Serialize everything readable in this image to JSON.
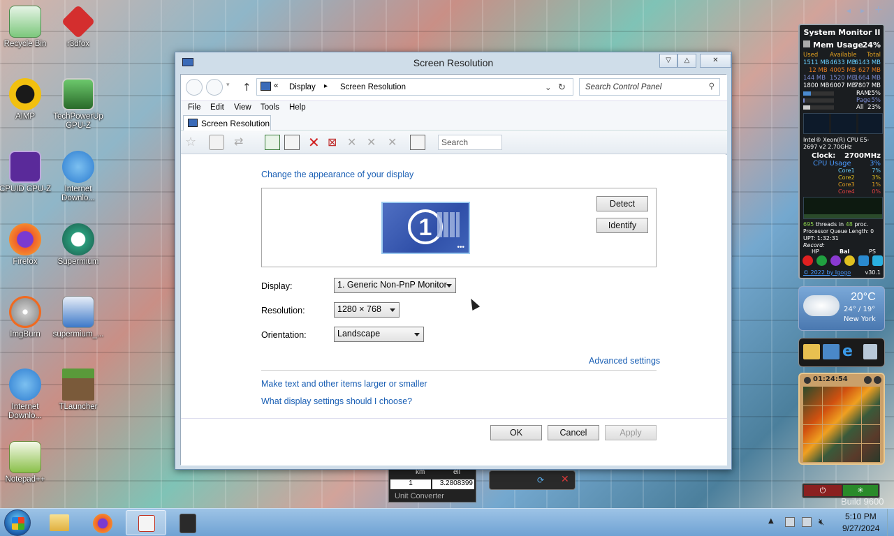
{
  "desktop": {
    "icons": [
      {
        "label": "Recycle Bin",
        "icon": "recycle-bin-icon",
        "color": "#3da63d"
      },
      {
        "label": "r3dfox",
        "icon": "r3dfox-icon",
        "color": "#d42e2e"
      },
      {
        "label": "AIMP",
        "icon": "aimp-icon",
        "color": "#f2c00f"
      },
      {
        "label": "TechPowerUp GPU-Z",
        "icon": "gpuz-icon",
        "color": "#4ca84c"
      },
      {
        "label": "CPUID CPU-Z",
        "icon": "cpuz-icon",
        "color": "#5a2a9a"
      },
      {
        "label": "Internet Downlo...",
        "icon": "idm-icon",
        "color": "#2b7bd0"
      },
      {
        "label": "Firefox",
        "icon": "firefox-icon",
        "color": "#f0602a"
      },
      {
        "label": "Supermium",
        "icon": "supermium-icon",
        "color": "#2a9a7a"
      },
      {
        "label": "ImgBurn",
        "icon": "imgburn-icon",
        "color": "#c8c8c8"
      },
      {
        "label": "supermium_...",
        "icon": "installer-icon",
        "color": "#3c78c8"
      },
      {
        "label": "Internet Downlo...",
        "icon": "idm-icon",
        "color": "#2b7bd0"
      },
      {
        "label": "TLauncher",
        "icon": "minecraft-icon",
        "color": "#5a8a3a"
      },
      {
        "label": "Notepad++",
        "icon": "notepadpp-icon",
        "color": "#8ac04a"
      }
    ]
  },
  "window": {
    "title": "Screen Resolution",
    "breadcrumb": {
      "chev": "«",
      "part1": "Display",
      "sep": "▸",
      "part2": "Screen Resolution"
    },
    "search_placeholder": "Search Control Panel",
    "menu": [
      "File",
      "Edit",
      "View",
      "Tools",
      "Help"
    ],
    "tab": "Screen Resolution",
    "toolbar_search": "Search",
    "content": {
      "heading": "Change the appearance of your display",
      "monitor_number": "1",
      "detect": "Detect",
      "identify": "Identify",
      "display_label": "Display:",
      "display_value": "1. Generic Non-PnP Monitor",
      "resolution_label": "Resolution:",
      "resolution_value": "1280 × 768",
      "orientation_label": "Orientation:",
      "orientation_value": "Landscape",
      "advanced": "Advanced settings",
      "link1": "Make text and other items larger or smaller",
      "link2": "What display settings should I choose?",
      "ok": "OK",
      "cancel": "Cancel",
      "apply": "Apply"
    }
  },
  "unit_converter": {
    "col1": "km",
    "col2": "ell",
    "val1": "1",
    "val2": "3.2808399",
    "label": "Unit Converter"
  },
  "sysmon": {
    "title": "System Monitor II",
    "mem_label": "Mem Usage",
    "mem_pct": "24%",
    "hdr": [
      "Used",
      "Available",
      "Total"
    ],
    "rows": [
      [
        "1511 MB",
        "4633 MB",
        "6143 MB"
      ],
      [
        "12 MB",
        "4005 MB",
        "627 MB"
      ],
      [
        "144 MB",
        "1520 MB",
        "1664 MB"
      ],
      [
        "1800 MB",
        "6007 MB",
        "7807 MB"
      ]
    ],
    "ram_label": "RAM",
    "ram_pct": "25%",
    "page_label": "Page",
    "page_pct": "5%",
    "all_label": "All",
    "all_pct": "23%",
    "cpu_name": "Intel® Xeon(R) CPU E5-2697 v2 2.70GHz",
    "clock_label": "Clock:",
    "clock_value": "2700MHz",
    "cpu_usage_label": "CPU Usage",
    "cpu_usage": "3%",
    "cores": [
      [
        "Core1",
        "7%"
      ],
      [
        "Core2",
        "3%"
      ],
      [
        "Core3",
        "1%"
      ],
      [
        "Core4",
        "0%"
      ]
    ],
    "threads": "695",
    "threads_text": "threads in",
    "procs": "48",
    "procs_text": "proc.",
    "queue": "Processor Queue Length: 0",
    "upt": "UPT: 1:32:31",
    "record": "Record:",
    "modes": [
      "HP",
      "Bal",
      "PS"
    ],
    "copyright": "© 2022 by Igogo",
    "version": "v30.1"
  },
  "weather": {
    "temp": "20°C",
    "range": "24° / 19°",
    "city": "New York"
  },
  "clock_gadget": {
    "time": "01:24:54"
  },
  "watermark": "Build 9600",
  "taskbar": {
    "time": "5:10 PM",
    "date": "9/27/2024"
  }
}
